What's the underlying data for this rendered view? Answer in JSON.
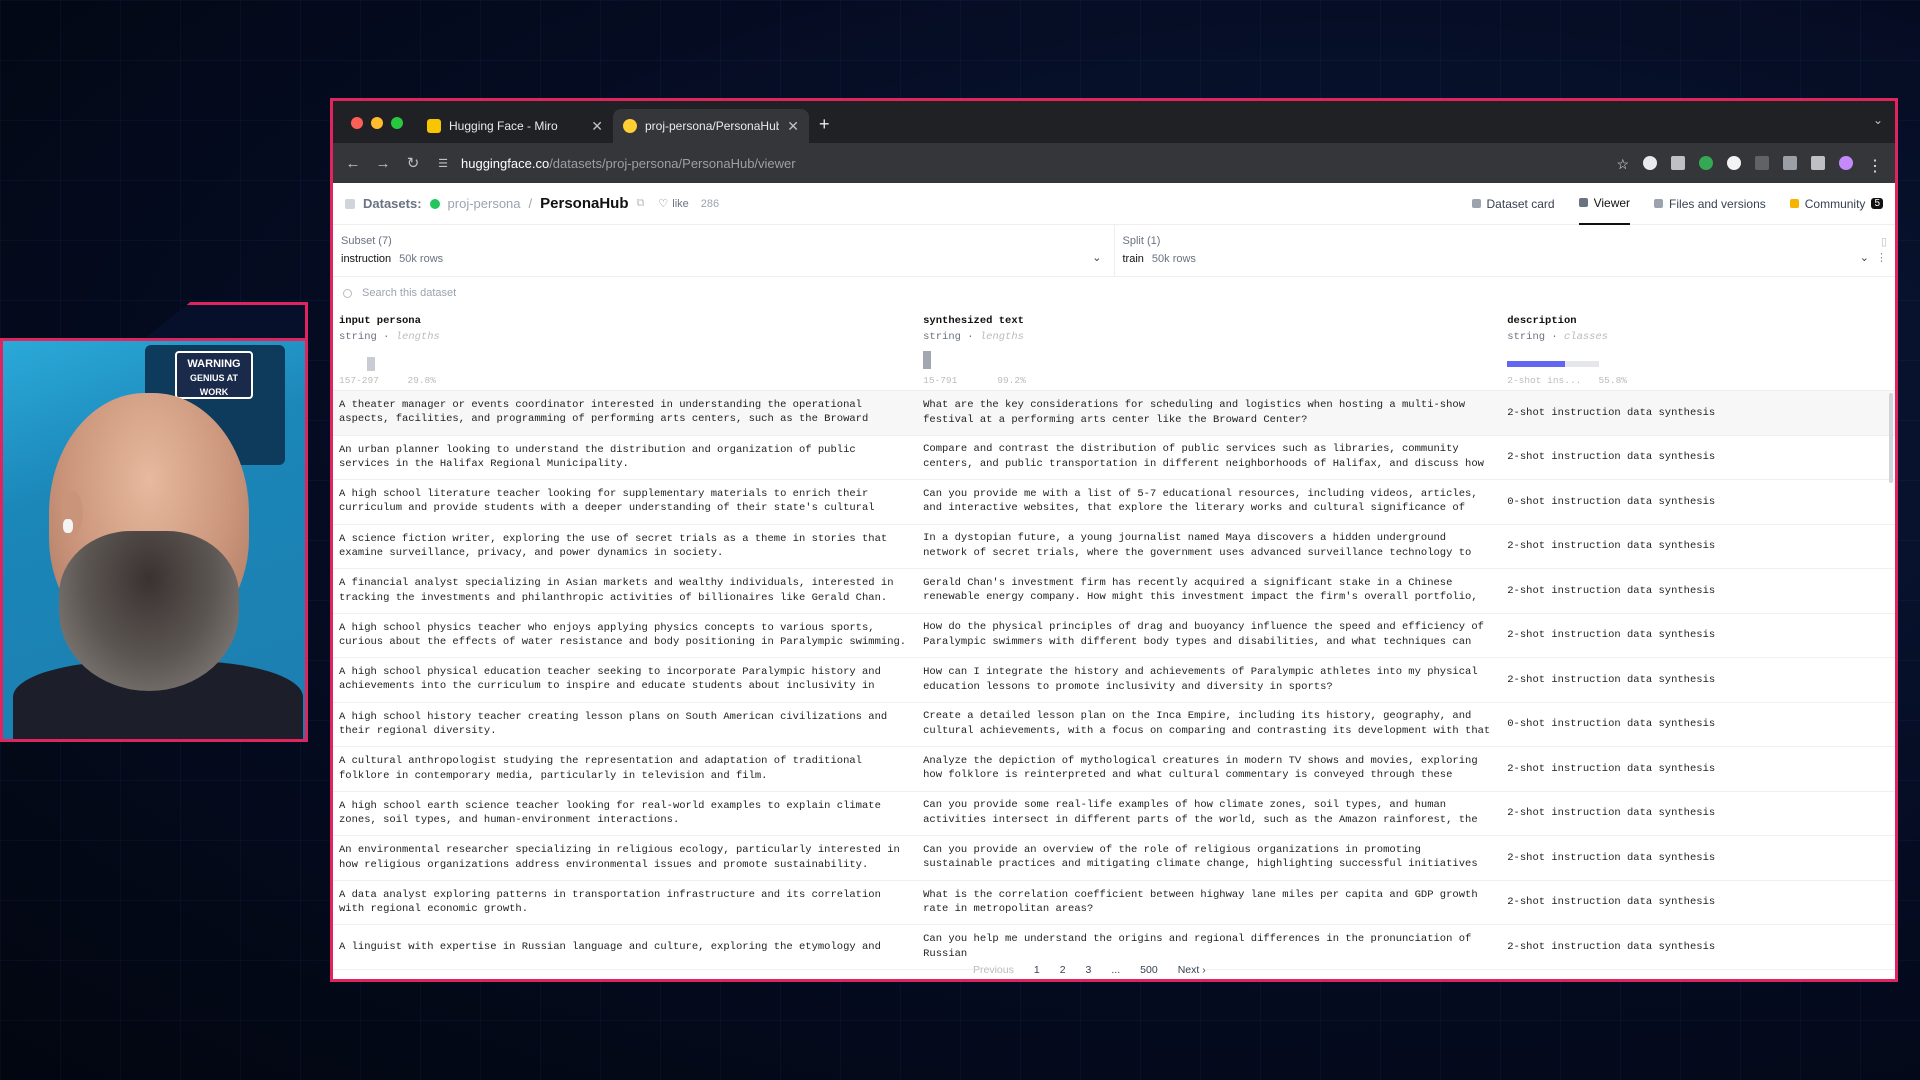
{
  "webcam": {
    "sign_line1": "WARNING",
    "sign_line2": "GENIUS AT WORK"
  },
  "browser": {
    "tabs": [
      {
        "title": "Hugging Face - Miro",
        "favicon_color": "#f7c600"
      },
      {
        "title": "proj-persona/PersonaHub · D",
        "favicon_color": "#ffcf33"
      }
    ],
    "url_host": "huggingface.co",
    "url_path": "/datasets/proj-persona/PersonaHub/viewer"
  },
  "header": {
    "datasets_label": "Datasets:",
    "org": "proj-persona",
    "repo": "PersonaHub",
    "like_label": "like",
    "like_count": "286",
    "nav": [
      {
        "label": "Dataset card"
      },
      {
        "label": "Viewer"
      },
      {
        "label": "Files and versions"
      },
      {
        "label": "Community",
        "badge": "5"
      }
    ]
  },
  "subset": {
    "label": "Subset (7)",
    "value": "instruction",
    "rows": "50k rows"
  },
  "split": {
    "label": "Split (1)",
    "value": "train",
    "rows": "50k rows"
  },
  "search": {
    "placeholder": "Search this dataset"
  },
  "columns": [
    {
      "name": "input persona",
      "type": "string",
      "stat": "lengths",
      "range": "157-297",
      "pct": "29.8%"
    },
    {
      "name": "synthesized text",
      "type": "string",
      "stat": "lengths",
      "range": "15-791",
      "pct": "99.2%"
    },
    {
      "name": "description",
      "type": "string",
      "stat": "classes",
      "range": "2-shot ins...",
      "pct": "55.8%"
    }
  ],
  "rows": [
    [
      "A theater manager or events coordinator interested in understanding the operational aspects, facilities, and programming of performing arts centers, such as the Broward Center.",
      "What are the key considerations for scheduling and logistics when hosting a multi-show festival at a performing arts center like the Broward Center?",
      "2-shot instruction data synthesis"
    ],
    [
      "An urban planner looking to understand the distribution and organization of public services in the Halifax Regional Municipality.",
      "Compare and contrast the distribution of public services such as libraries, community centers, and public transportation in different neighborhoods of Halifax, and discuss how the municipal…",
      "2-shot instruction data synthesis"
    ],
    [
      "A high school literature teacher looking for supplementary materials to enrich their curriculum and provide students with a deeper understanding of their state's cultural heritage.",
      "Can you provide me with a list of 5-7 educational resources, including videos, articles, and interactive websites, that explore the literary works and cultural significance of Native…",
      "0-shot instruction data synthesis"
    ],
    [
      "A science fiction writer, exploring the use of secret trials as a theme in stories that examine surveillance, privacy, and power dynamics in society.",
      "In a dystopian future, a young journalist named Maya discovers a hidden underground network of secret trials, where the government uses advanced surveillance technology to manipulate and…",
      "2-shot instruction data synthesis"
    ],
    [
      "A financial analyst specializing in Asian markets and wealthy individuals, interested in tracking the investments and philanthropic activities of billionaires like Gerald Chan.",
      "Gerald Chan's investment firm has recently acquired a significant stake in a Chinese renewable energy company. How might this investment impact the firm's overall portfolio, and what potentia…",
      "2-shot instruction data synthesis"
    ],
    [
      "A high school physics teacher who enjoys applying physics concepts to various sports, curious about the effects of water resistance and body positioning in Paralympic swimming.",
      "How do the physical principles of drag and buoyancy influence the speed and efficiency of Paralympic swimmers with different body types and disabilities, and what techniques can coaches…",
      "2-shot instruction data synthesis"
    ],
    [
      "A high school physical education teacher seeking to incorporate Paralympic history and achievements into the curriculum to inspire and educate students about inclusivity in sports.",
      "How can I integrate the history and achievements of Paralympic athletes into my physical education lessons to promote inclusivity and diversity in sports?",
      "2-shot instruction data synthesis"
    ],
    [
      "A high school history teacher creating lesson plans on South American civilizations and their regional diversity.",
      "Create a detailed lesson plan on the Inca Empire, including its history, geography, and cultural achievements, with a focus on comparing and contrasting its development with that of the Aztec…",
      "0-shot instruction data synthesis"
    ],
    [
      "A cultural anthropologist studying the representation and adaptation of traditional folklore in contemporary media, particularly in television and film.",
      "Analyze the depiction of mythological creatures in modern TV shows and movies, exploring how folklore is reinterpreted and what cultural commentary is conveyed through these representations.",
      "2-shot instruction data synthesis"
    ],
    [
      "A high school earth science teacher looking for real-world examples to explain climate zones, soil types, and human-environment interactions.",
      "Can you provide some real-life examples of how climate zones, soil types, and human activities intersect in different parts of the world, such as the Amazon rainforest, the Sahara Desert, or…",
      "2-shot instruction data synthesis"
    ],
    [
      "An environmental researcher specializing in religious ecology, particularly interested in how religious organizations address environmental issues and promote sustainability.",
      "Can you provide an overview of the role of religious organizations in promoting sustainable practices and mitigating climate change, highlighting successful initiatives and collaborations…",
      "2-shot instruction data synthesis"
    ],
    [
      "A data analyst exploring patterns in transportation infrastructure and its correlation with regional economic growth.",
      "What is the correlation coefficient between highway lane miles per capita and GDP growth rate in metropolitan areas?",
      "2-shot instruction data synthesis"
    ],
    [
      "A linguist with expertise in Russian language and culture, exploring the etymology and",
      "Can you help me understand the origins and regional differences in the pronunciation of Russian",
      "2-shot instruction data synthesis"
    ]
  ],
  "pagination": {
    "prev": "Previous",
    "pages": [
      "1",
      "2",
      "3",
      "...",
      "500"
    ],
    "next": "Next"
  }
}
